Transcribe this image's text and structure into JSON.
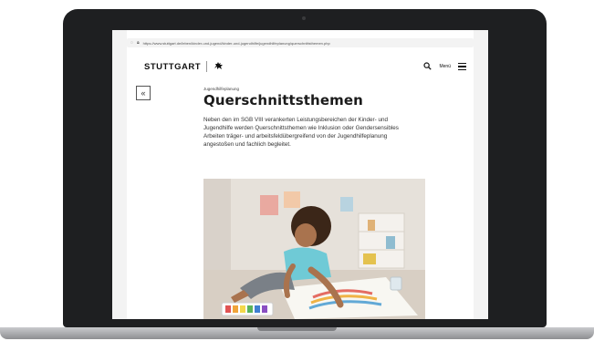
{
  "browser": {
    "url": "https://www.stuttgart.de/leben/kinder-und-jugend/kinder-und-jugendhilfe/jugendhilfeplanung/querschnittsthemen.php"
  },
  "header": {
    "logo_text": "STUTTGART",
    "menu_label": "Menü"
  },
  "page": {
    "breadcrumb": "Jugendhilfeplanung",
    "title": "Querschnittsthemen",
    "intro": "Neben den im SGB VIII verankerten Leistungsbereichen der Kinder- und Jugendhilfe werden Querschnittsthemen wie Inklusion oder Gendersensibles Arbeiten träger- und arbeitsfeldübergreifend von der Jugendhilfeplanung angestoßen und fachlich begleitet."
  },
  "icons": {
    "back": "double-chevron-left-icon",
    "search": "search-icon",
    "menu": "hamburger-menu-icon",
    "lock": "lock-icon",
    "logo_mark": "horse-icon"
  },
  "colors": {
    "laptop_bezel": "#1e1f21",
    "title_text": "#1b1b1b",
    "body_text": "#333333"
  }
}
